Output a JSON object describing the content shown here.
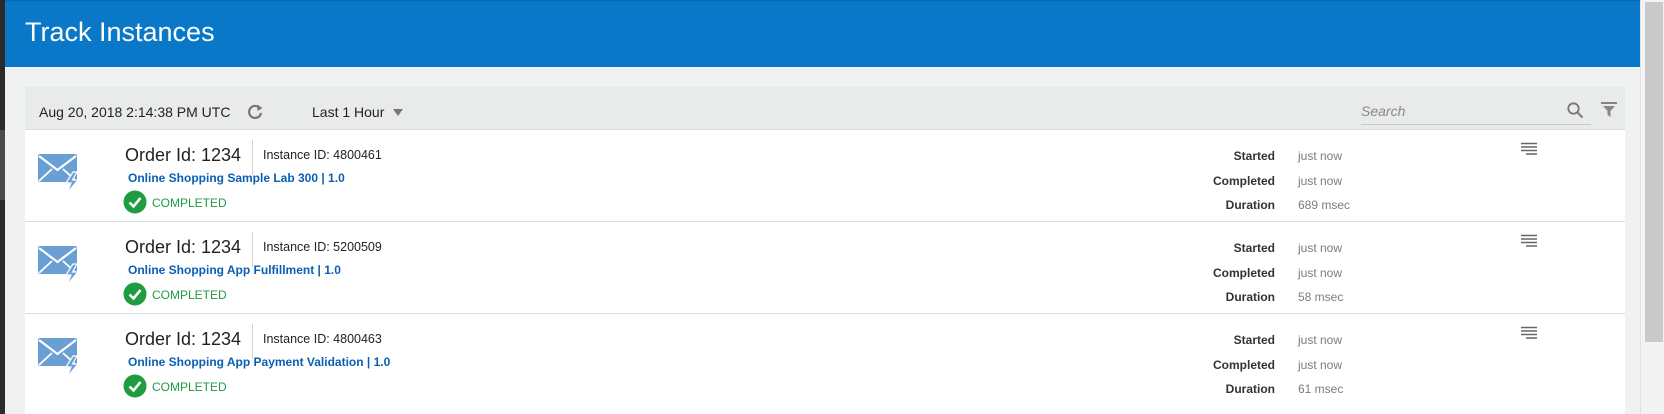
{
  "header": {
    "title": "Track Instances"
  },
  "toolbar": {
    "timestamp": "Aug 20, 2018 2:14:38 PM UTC",
    "time_range": "Last 1 Hour",
    "search_placeholder": "Search"
  },
  "labels": {
    "started": "Started",
    "completed": "Completed",
    "duration": "Duration"
  },
  "rows": [
    {
      "order": "Order Id: 1234",
      "instance": "Instance ID: 4800461",
      "app": "Online Shopping Sample Lab 300 | 1.0",
      "status": "COMPLETED",
      "started": "just now",
      "completed": "just now",
      "duration": "689 msec"
    },
    {
      "order": "Order Id: 1234",
      "instance": "Instance ID: 5200509",
      "app": "Online Shopping App Fulfillment | 1.0",
      "status": "COMPLETED",
      "started": "just now",
      "completed": "just now",
      "duration": "58 msec"
    },
    {
      "order": "Order Id: 1234",
      "instance": "Instance ID: 4800463",
      "app": "Online Shopping App Payment Validation | 1.0",
      "status": "COMPLETED",
      "started": "just now",
      "completed": "just now",
      "duration": "61 msec"
    }
  ],
  "colors": {
    "header_bg": "#0a78c8",
    "link": "#0a5fb4",
    "status_completed": "#1f9b41",
    "icon_blue": "#6a9fd4"
  },
  "icons": {
    "refresh": "refresh-icon",
    "dropdown": "chevron-down-icon",
    "search": "search-icon",
    "filter": "filter-icon",
    "row_type": "message-event-icon",
    "status": "check-circle-icon",
    "row_menu": "menu-icon"
  }
}
